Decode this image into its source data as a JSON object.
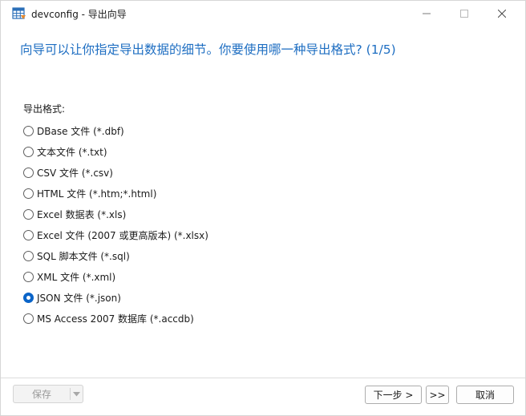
{
  "window": {
    "title": "devconfig - 导出向导",
    "icon": "table-icon"
  },
  "wizard": {
    "heading": "向导可以让你指定导出数据的细节。你要使用哪一种导出格式? (1/5)",
    "group_label": "导出格式:",
    "formats": [
      {
        "label": "DBase 文件 (*.dbf)",
        "selected": false
      },
      {
        "label": "文本文件 (*.txt)",
        "selected": false
      },
      {
        "label": "CSV 文件 (*.csv)",
        "selected": false
      },
      {
        "label": "HTML 文件 (*.htm;*.html)",
        "selected": false
      },
      {
        "label": "Excel 数据表 (*.xls)",
        "selected": false
      },
      {
        "label": "Excel 文件 (2007 或更高版本) (*.xlsx)",
        "selected": false
      },
      {
        "label": "SQL 脚本文件 (*.sql)",
        "selected": false
      },
      {
        "label": "XML 文件 (*.xml)",
        "selected": false
      },
      {
        "label": "JSON 文件 (*.json)",
        "selected": true
      },
      {
        "label": "MS Access 2007 数据库 (*.accdb)",
        "selected": false
      }
    ]
  },
  "footer": {
    "save_label": "保存",
    "next_label": "下一步 >",
    "last_label": ">>",
    "cancel_label": "取消"
  },
  "colors": {
    "heading": "#1e6ec2",
    "selected_radio": "#0a64c8"
  }
}
